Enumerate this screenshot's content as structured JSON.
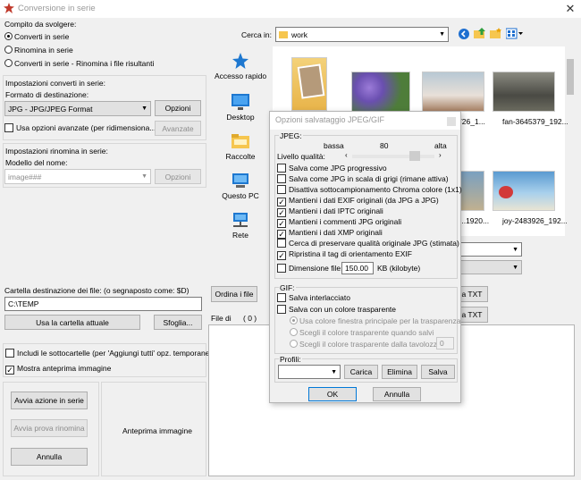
{
  "window": {
    "title": "Conversione in serie",
    "close_glyph": "✕"
  },
  "task": {
    "heading": "Compito da svolgere:",
    "options": [
      {
        "label": "Converti in serie",
        "selected": true
      },
      {
        "label": "Rinomina in serie",
        "selected": false
      },
      {
        "label": "Converti in serie - Rinomina i file risultanti",
        "selected": false
      }
    ]
  },
  "convert": {
    "heading": "Impostazioni converti in serie:",
    "format_label": "Formato di destinazione:",
    "format_value": "JPG - JPG/JPEG Format",
    "options_button": "Opzioni",
    "advanced_check": "Usa opzioni avanzate (per ridimensiona...)",
    "advanced_button": "Avanzate"
  },
  "rename": {
    "heading": "Impostazioni rinomina in serie:",
    "model_label": "Modello del nome:",
    "model_value": "image###",
    "options_button": "Opzioni"
  },
  "destination": {
    "label": "Cartella destinazione dei file: (o segnaposto come: $D)",
    "value": "C:\\TEMP",
    "use_current_button": "Usa la cartella attuale",
    "browse_button": "Sfoglia..."
  },
  "include_subfolders": "Includi le sottocartelle (per 'Aggiungi tutti' opz. temporanea)",
  "show_preview": "Mostra anteprima immagine",
  "actions": {
    "start": "Avvia azione in serie",
    "test_rename": "Avvia prova rinomina",
    "cancel": "Annulla"
  },
  "preview_label": "Anteprima immagine",
  "browser": {
    "lookin_label": "Cerca in:",
    "lookin_value": "work",
    "places": [
      "Accesso rapido",
      "Desktop",
      "Raccolte",
      "Questo PC",
      "Rete"
    ],
    "files": [
      {
        "name": ""
      },
      {
        "name": ""
      },
      {
        "name": "...726_1..."
      },
      {
        "name": "fan-3645379_192..."
      },
      {
        "name": "...1920..."
      },
      {
        "name": "joy-2483926_192..."
      }
    ]
  },
  "list": {
    "sort_button": "Ordina i file",
    "files_label": "File di",
    "files_count": "( 0 )",
    "txt_button_1": "a TXT",
    "txt_button_2": "a TXT"
  },
  "jpeg_dialog": {
    "title": "Opzioni salvataggio JPEG/GIF",
    "jpeg_group": "JPEG:",
    "quality_low": "bassa",
    "quality_value": "80",
    "quality_high": "alta",
    "quality_label": "Livello qualità:",
    "quality_fraction": 0.8,
    "options": [
      {
        "label": "Salva come JPG progressivo",
        "checked": false
      },
      {
        "label": "Salva come JPG in scala di grigi (rimane attiva)",
        "checked": false
      },
      {
        "label": "Disattiva sottocampionamento Chroma colore (1x1)",
        "checked": false
      },
      {
        "label": "Mantieni i dati EXIF originali (da JPG a JPG)",
        "checked": true
      },
      {
        "label": "Mantieni i dati IPTC originali",
        "checked": true
      },
      {
        "label": "Mantieni i commenti JPG originali",
        "checked": true
      },
      {
        "label": "Mantieni i dati XMP originali",
        "checked": true
      },
      {
        "label": "Cerca di preservare qualità originale JPG (stimata)",
        "checked": false
      },
      {
        "label": "Ripristina il tag di orientamento EXIF",
        "checked": true
      }
    ],
    "filesize_label": "Dimensione file:",
    "filesize_value": "150.00",
    "filesize_unit": "KB (kilobyte)",
    "gif_group": "GIF:",
    "gif_interlaced": "Salva interlacciato",
    "gif_transparent": "Salva con un colore trasparente",
    "gif_radio": [
      {
        "label": "Usa colore finestra principale per la trasparenza",
        "selected": true
      },
      {
        "label": "Scegli il colore trasparente quando salvi",
        "selected": false
      },
      {
        "label": "Scegli il colore trasparente dalla tavolozza:",
        "selected": false
      }
    ],
    "palette_value": "0",
    "profiles_label": "Profili:",
    "load_button": "Carica",
    "delete_button": "Elimina",
    "save_button": "Salva",
    "ok_button": "OK",
    "cancel_button": "Annulla"
  },
  "colors": {
    "accent": "#0078d7",
    "folder": "#f6c64f"
  }
}
